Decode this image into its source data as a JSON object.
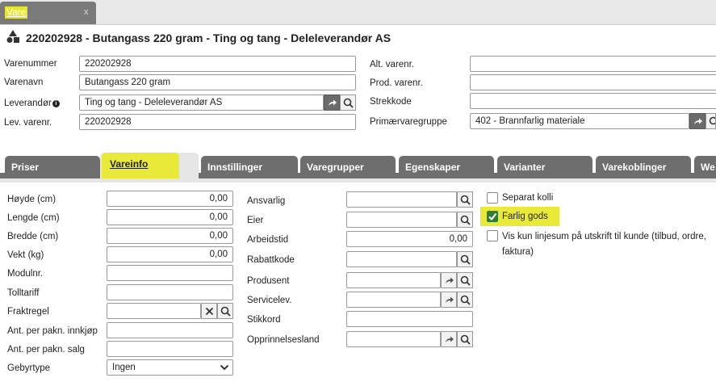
{
  "doc_tab": {
    "label": "Vare",
    "close": "x"
  },
  "header": {
    "title": "220202928 - Butangass 220 gram - Ting og tang - Deleleverandør AS"
  },
  "left_form": {
    "varenummer": {
      "label": "Varenummer",
      "value": "220202928"
    },
    "varenavn": {
      "label": "Varenavn",
      "value": "Butangass 220 gram"
    },
    "leverandor": {
      "label": "Leverandør",
      "value": "Ting og tang - Deleleverandør AS",
      "info": "i"
    },
    "lev_varenr": {
      "label": "Lev. varenr.",
      "value": "220202928"
    }
  },
  "right_form": {
    "alt_varenr": {
      "label": "Alt. varenr.",
      "value": ""
    },
    "prod_varenr": {
      "label": "Prod. varenr.",
      "value": ""
    },
    "strekkode": {
      "label": "Strekkode",
      "value": ""
    },
    "primaervaregruppe": {
      "label": "Primærvaregruppe",
      "value": "402 - Brannfarlig materiale"
    }
  },
  "tabs": [
    {
      "label": "Priser"
    },
    {
      "label": "Vareinfo"
    },
    {
      "label": "Innstillinger"
    },
    {
      "label": "Varegrupper"
    },
    {
      "label": "Egenskaper"
    },
    {
      "label": "Varianter"
    },
    {
      "label": "Varekoblinger"
    },
    {
      "label": "We"
    }
  ],
  "vareinfo_col1": {
    "hoyde": {
      "label": "Høyde (cm)",
      "value": "0,00"
    },
    "lengde": {
      "label": "Lengde (cm)",
      "value": "0,00"
    },
    "bredde": {
      "label": "Bredde (cm)",
      "value": "0,00"
    },
    "vekt": {
      "label": "Vekt (kg)",
      "value": "0,00"
    },
    "modulnr": {
      "label": "Modulnr.",
      "value": ""
    },
    "tolltariff": {
      "label": "Tolltariff",
      "value": ""
    },
    "fraktregel": {
      "label": "Fraktregel",
      "value": ""
    },
    "ant_innkjop": {
      "label": "Ant. per pakn. innkjøp",
      "value": ""
    },
    "ant_salg": {
      "label": "Ant. per pakn. salg",
      "value": ""
    },
    "gebyrtype": {
      "label": "Gebyrtype",
      "value": "Ingen"
    }
  },
  "vareinfo_col2": {
    "ansvarlig": {
      "label": "Ansvarlig",
      "value": ""
    },
    "eier": {
      "label": "Eier",
      "value": ""
    },
    "arbeidstid": {
      "label": "Arbeidstid",
      "value": "0,00"
    },
    "rabattkode": {
      "label": "Rabattkode",
      "value": ""
    },
    "produsent": {
      "label": "Produsent",
      "value": ""
    },
    "servicelev": {
      "label": "Servicelev.",
      "value": ""
    },
    "stikkord": {
      "label": "Stikkord",
      "value": ""
    },
    "opprinnelsesland": {
      "label": "Opprinnelsesland",
      "value": ""
    }
  },
  "checkboxes": {
    "separat_kolli": {
      "label": "Separat kolli",
      "checked": false
    },
    "farlig_gods": {
      "label": "Farlig gods",
      "checked": true
    },
    "vis_kun": {
      "label_line1": "Vis kun linjesum på utskrift til kunde (tilbud, ordre,",
      "label_line2": "faktura)",
      "checked": false
    }
  },
  "colors": {
    "highlight": "#e9e93a",
    "tab_bg": "#6e6e6e",
    "check_green": "#2e7d32"
  },
  "icons": {
    "title": "shapes-icon",
    "search": "search-icon",
    "link": "arrow-link-icon",
    "clear": "close-icon",
    "dropdown": "chevron-down-icon"
  }
}
